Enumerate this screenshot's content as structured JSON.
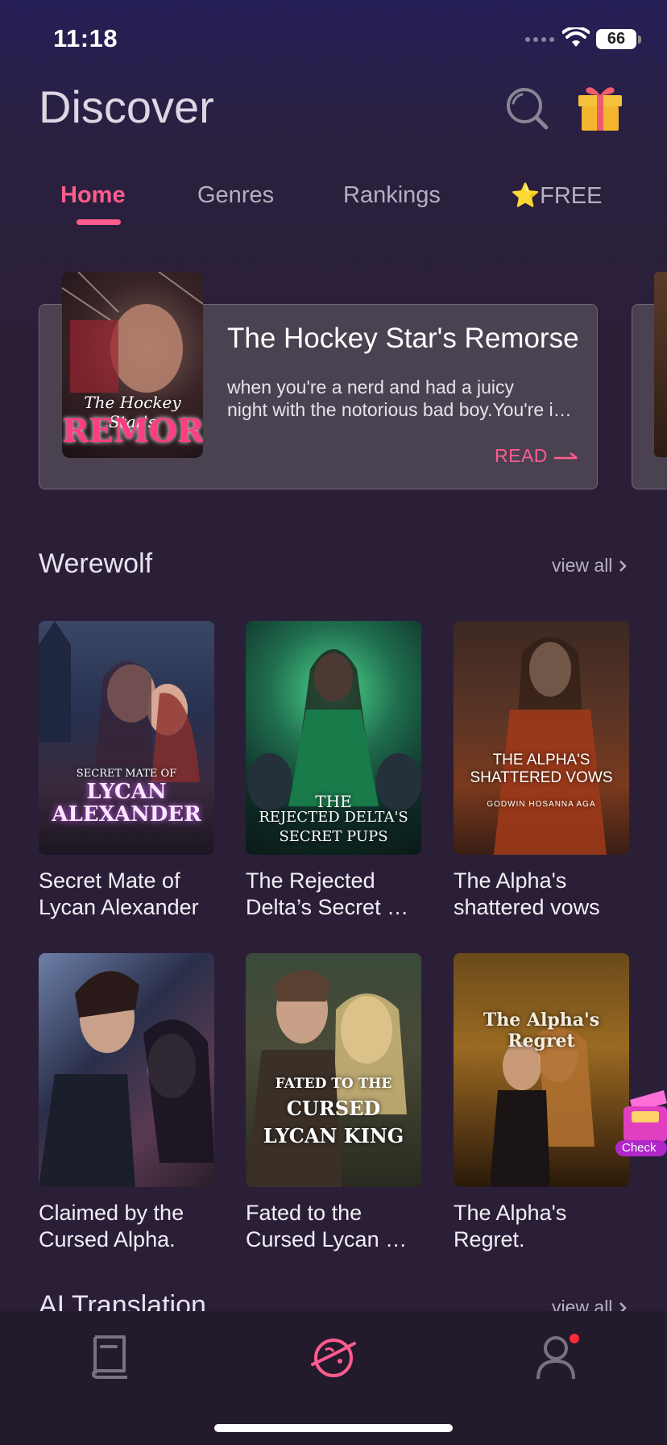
{
  "status_bar": {
    "time": "11:18",
    "battery": "66"
  },
  "header": {
    "title": "Discover"
  },
  "tabs": [
    {
      "label": "Home",
      "active": true
    },
    {
      "label": "Genres",
      "active": false
    },
    {
      "label": "Rankings",
      "active": false
    },
    {
      "label": "⭐FREE",
      "active": false
    }
  ],
  "featured": {
    "title": "The Hockey Star's Remorse",
    "cover_line1": "The Hockey Star's",
    "cover_line2": "REMORSE",
    "description_line1": "when you're a nerd and had a juicy",
    "description_line2": "night with the notorious bad boy.You're in love with him",
    "read_label": "READ"
  },
  "section": {
    "title": "Werewolf",
    "view_all": "view all",
    "books": [
      {
        "line1": "Secret Mate of",
        "line2": "Lycan Alexander",
        "cover_small": "SECRET MATE OF",
        "cover_big": "LYCAN ALEXANDER"
      },
      {
        "line1": "The Rejected",
        "line2": "Delta’s Secret Pups",
        "cover_small": "THE",
        "cover_big": "REJECTED DELTA'S SECRET PUPS"
      },
      {
        "line1": "The Alpha's",
        "line2": "shattered vows",
        "cover_small": "THE ALPHA'S SHATTERED VOWS",
        "cover_big": "GODWIN HOSANNA AGA"
      },
      {
        "line1": "Claimed by the",
        "line2": "Cursed Alpha.",
        "cover_small": "",
        "cover_big": ""
      },
      {
        "line1": "Fated to the",
        "line2": "Cursed Lycan King",
        "cover_small": "FATED TO THE",
        "cover_big": "CURSED LYCAN KING"
      },
      {
        "line1": "The Alpha's",
        "line2": "Regret.",
        "cover_small": "The Alpha's Regret",
        "cover_big": ""
      }
    ]
  },
  "next_section": {
    "title": "AI Translation",
    "view_all": "view all"
  },
  "checkin": {
    "label": "Check"
  },
  "colors": {
    "accent": "#ff5c8d",
    "background": "#2b1f38",
    "card": "#4a4250"
  },
  "nav": [
    "library-icon",
    "discover-icon",
    "profile-icon"
  ]
}
